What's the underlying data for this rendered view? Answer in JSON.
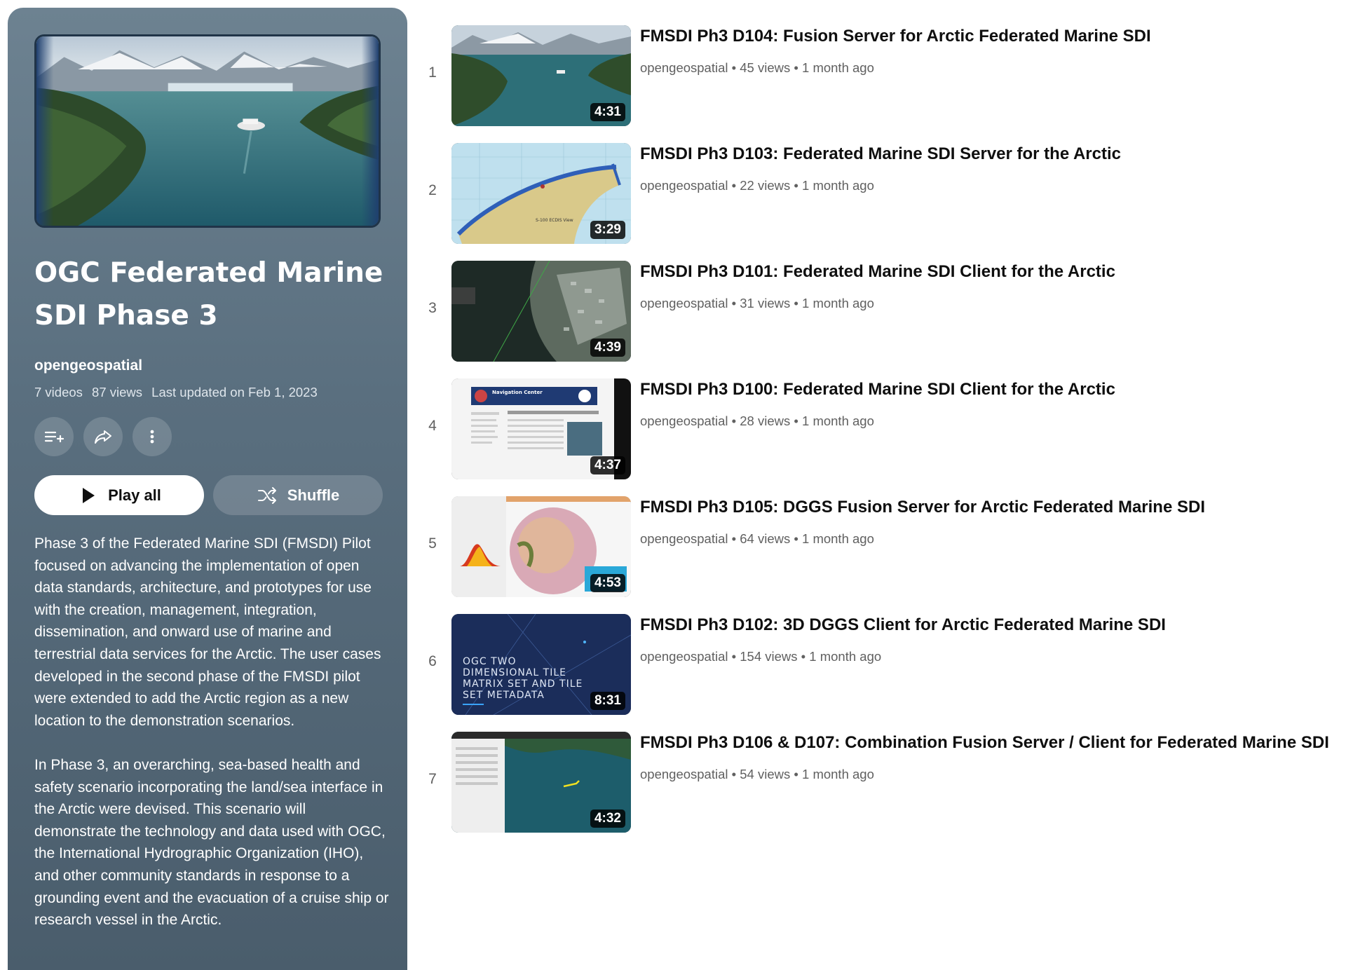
{
  "playlist": {
    "title": "OGC Federated Marine SDI Phase 3",
    "owner": "opengeospatial",
    "video_count": "7 videos",
    "view_count": "87 views",
    "updated": "Last updated on Feb 1, 2023",
    "play_all_label": "Play all",
    "shuffle_label": "Shuffle",
    "description": [
      "Phase 3 of the Federated Marine SDI (FMSDI) Pilot focused on advancing the implementation of open data standards, architecture, and prototypes for use with the creation, management, integration, dissemination, and onward use of marine and terrestrial data services for the Arctic. The user cases developed in the second phase of the FMSDI pilot were extended to add the Arctic region as a new location to the demonstration scenarios.",
      "In Phase 3, an overarching, sea-based health and safety scenario incorporating the land/sea interface in the Arctic were devised. This scenario will demonstrate the technology and data used with OGC, the International Hydrographic Organization (IHO), and other community standards in response to a grounding event and the evacuation of a cruise ship or research vessel in the Arctic."
    ],
    "icons": [
      "add-to-queue-icon",
      "share-icon",
      "more-vert-icon",
      "play-icon",
      "shuffle-icon"
    ]
  },
  "videos": [
    {
      "index": "1",
      "title": "FMSDI Ph3 D104: Fusion Server for Arctic Federated Marine SDI",
      "channel": "opengeospatial",
      "views": "45 views",
      "age": "1 month ago",
      "duration": "4:31"
    },
    {
      "index": "2",
      "title": "FMSDI Ph3 D103: Federated Marine SDI Server for the Arctic",
      "channel": "opengeospatial",
      "views": "22 views",
      "age": "1 month ago",
      "duration": "3:29",
      "thumb_text": "S-100 ECDIS View"
    },
    {
      "index": "3",
      "title": "FMSDI Ph3 D101: Federated Marine SDI Client for the Arctic",
      "channel": "opengeospatial",
      "views": "31 views",
      "age": "1 month ago",
      "duration": "4:39"
    },
    {
      "index": "4",
      "title": "FMSDI Ph3 D100: Federated Marine SDI Client for the Arctic",
      "channel": "opengeospatial",
      "views": "28 views",
      "age": "1 month ago",
      "duration": "4:37",
      "thumb_text": "Navigation Center"
    },
    {
      "index": "5",
      "title": "FMSDI Ph3 D105: DGGS Fusion Server for Arctic Federated Marine SDI",
      "channel": "opengeospatial",
      "views": "64 views",
      "age": "1 month ago",
      "duration": "4:53"
    },
    {
      "index": "6",
      "title": "FMSDI Ph3 D102: 3D DGGS Client for Arctic Federated Marine SDI",
      "channel": "opengeospatial",
      "views": "154 views",
      "age": "1 month ago",
      "duration": "8:31",
      "thumb_text": [
        "OGC TWO",
        "DIMENSIONAL TILE",
        "MATRIX SET AND TILE",
        "SET METADATA"
      ]
    },
    {
      "index": "7",
      "title": "FMSDI Ph3 D106 & D107: Combination Fusion Server / Client for Federated Marine SDI",
      "channel": "opengeospatial",
      "views": "54 views",
      "age": "1 month ago",
      "duration": "4:32"
    }
  ]
}
